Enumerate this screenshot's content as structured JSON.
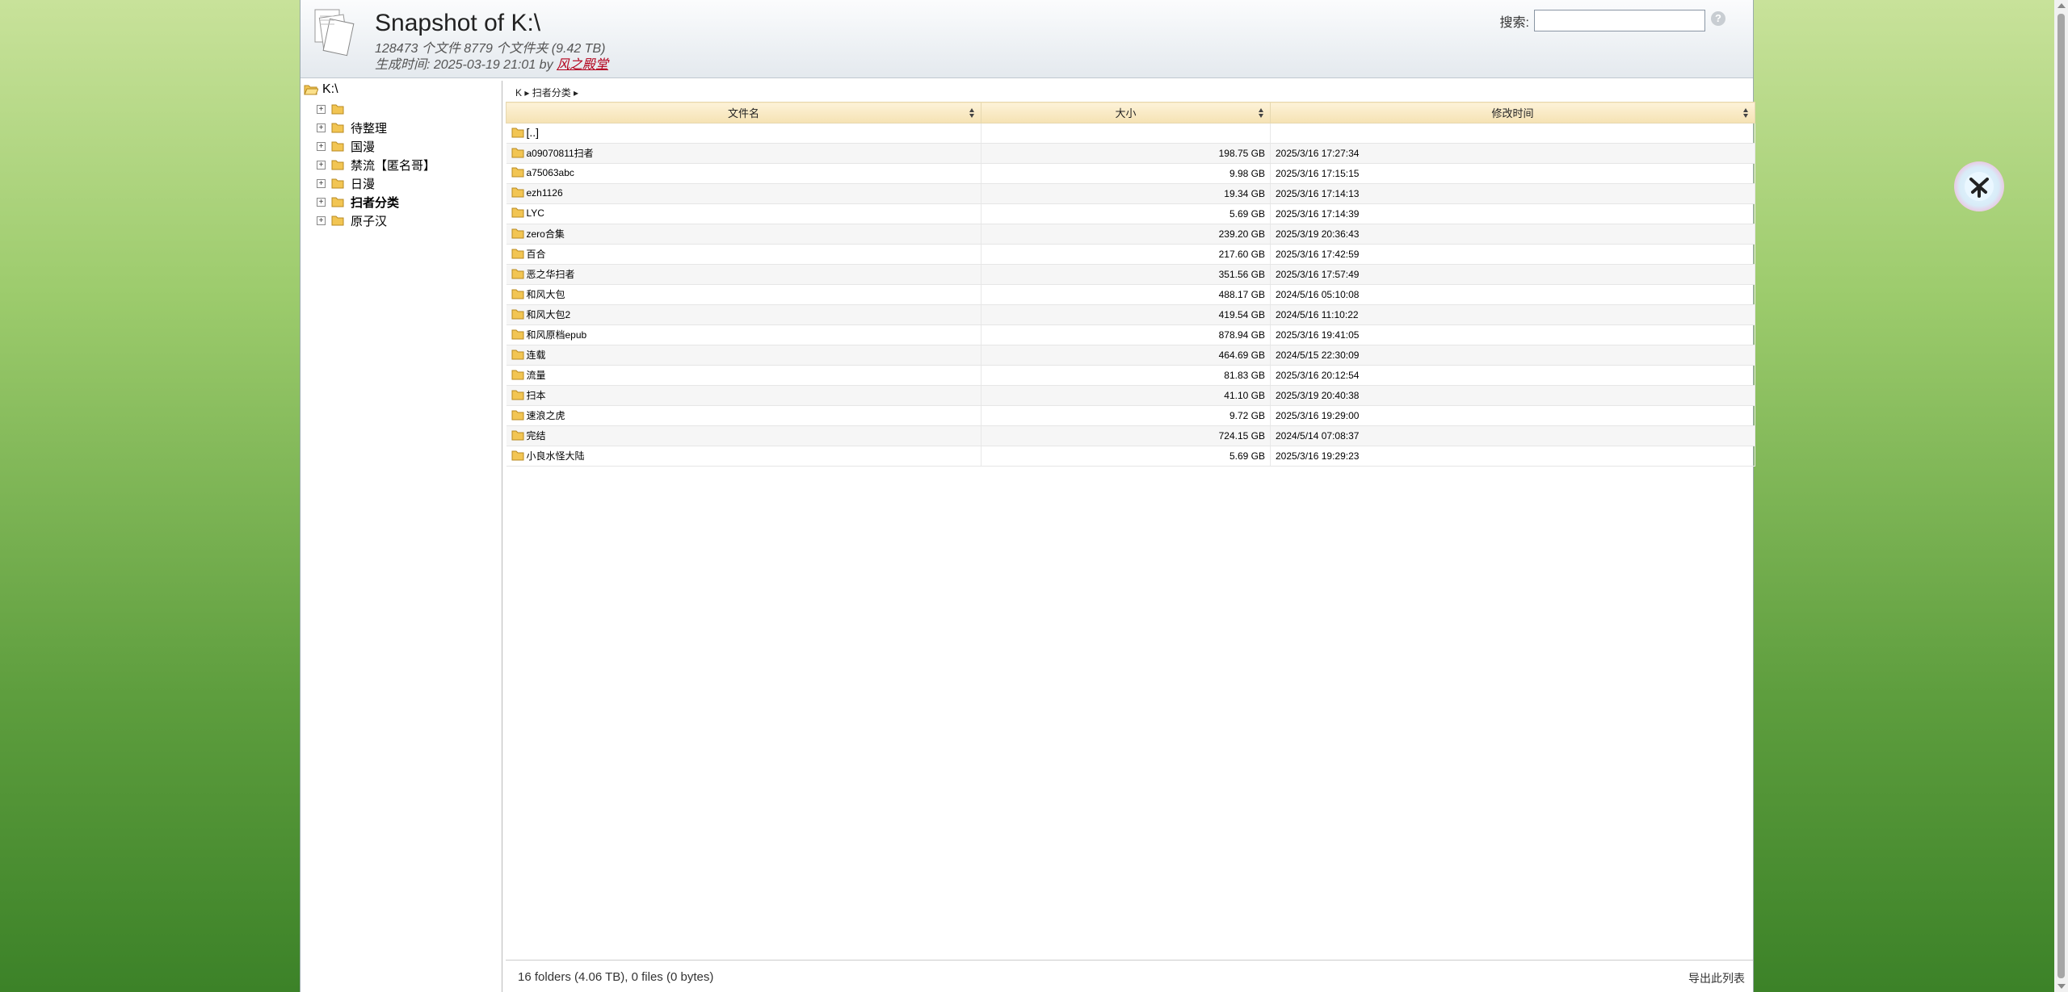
{
  "header": {
    "title": "Snapshot of K:\\",
    "counts": "128473 个文件 8779 个文件夹 (9.42 TB)",
    "generated_prefix": "生成时间:  2025-03-19 21:01 by ",
    "author_link": "风之殿堂",
    "search_label": "搜索:",
    "search_value": "",
    "help_glyph": "?"
  },
  "tree": {
    "root": "K:\\",
    "items": [
      {
        "label": "",
        "bold": false
      },
      {
        "label": "待整理",
        "bold": false
      },
      {
        "label": "国漫",
        "bold": false
      },
      {
        "label": "禁流【匿名哥】",
        "bold": false
      },
      {
        "label": "日漫",
        "bold": false
      },
      {
        "label": "扫者分类",
        "bold": true
      },
      {
        "label": "原子汉",
        "bold": false
      }
    ]
  },
  "breadcrumb": "K ▸ 扫者分类 ▸",
  "table": {
    "columns": [
      "文件名",
      "大小",
      "修改时间"
    ],
    "parent_row": "[..]",
    "rows": [
      {
        "name": "a09070811扫者",
        "size": "198.75 GB",
        "modified": "2025/3/16 17:27:34"
      },
      {
        "name": "a75063abc",
        "size": "9.98 GB",
        "modified": "2025/3/16 17:15:15"
      },
      {
        "name": "ezh1126",
        "size": "19.34 GB",
        "modified": "2025/3/16 17:14:13"
      },
      {
        "name": "LYC",
        "size": "5.69 GB",
        "modified": "2025/3/16 17:14:39"
      },
      {
        "name": "zero合集",
        "size": "239.20 GB",
        "modified": "2025/3/19 20:36:43"
      },
      {
        "name": "百合",
        "size": "217.60 GB",
        "modified": "2025/3/16 17:42:59"
      },
      {
        "name": "恶之华扫者",
        "size": "351.56 GB",
        "modified": "2025/3/16 17:57:49"
      },
      {
        "name": "和风大包",
        "size": "488.17 GB",
        "modified": "2024/5/16 05:10:08"
      },
      {
        "name": "和风大包2",
        "size": "419.54 GB",
        "modified": "2024/5/16 11:10:22"
      },
      {
        "name": "和风原档epub",
        "size": "878.94 GB",
        "modified": "2025/3/16 19:41:05"
      },
      {
        "name": "连载",
        "size": "464.69 GB",
        "modified": "2024/5/15 22:30:09"
      },
      {
        "name": "流量",
        "size": "81.83 GB",
        "modified": "2025/3/16 20:12:54"
      },
      {
        "name": "扫本",
        "size": "41.10 GB",
        "modified": "2025/3/19 20:40:38"
      },
      {
        "name": "速浪之虎",
        "size": "9.72 GB",
        "modified": "2025/3/16 19:29:00"
      },
      {
        "name": "完结",
        "size": "724.15 GB",
        "modified": "2024/5/14 07:08:37"
      },
      {
        "name": "小良水怪大陆",
        "size": "5.69 GB",
        "modified": "2025/3/16 19:29:23"
      }
    ]
  },
  "status": {
    "summary": "16 folders (4.06 TB), 0 files (0 bytes)",
    "export": "导出此列表"
  },
  "colors": {
    "header_bg": "#e4e9ee",
    "table_header": "#f5e2b3",
    "folder": "#f2c553",
    "link": "#b3001b"
  },
  "icons": [
    "document-stack-icon",
    "folder-icon",
    "folder-open-icon",
    "expand-plus-icon",
    "sort-icon",
    "help-icon",
    "extension-icon"
  ]
}
